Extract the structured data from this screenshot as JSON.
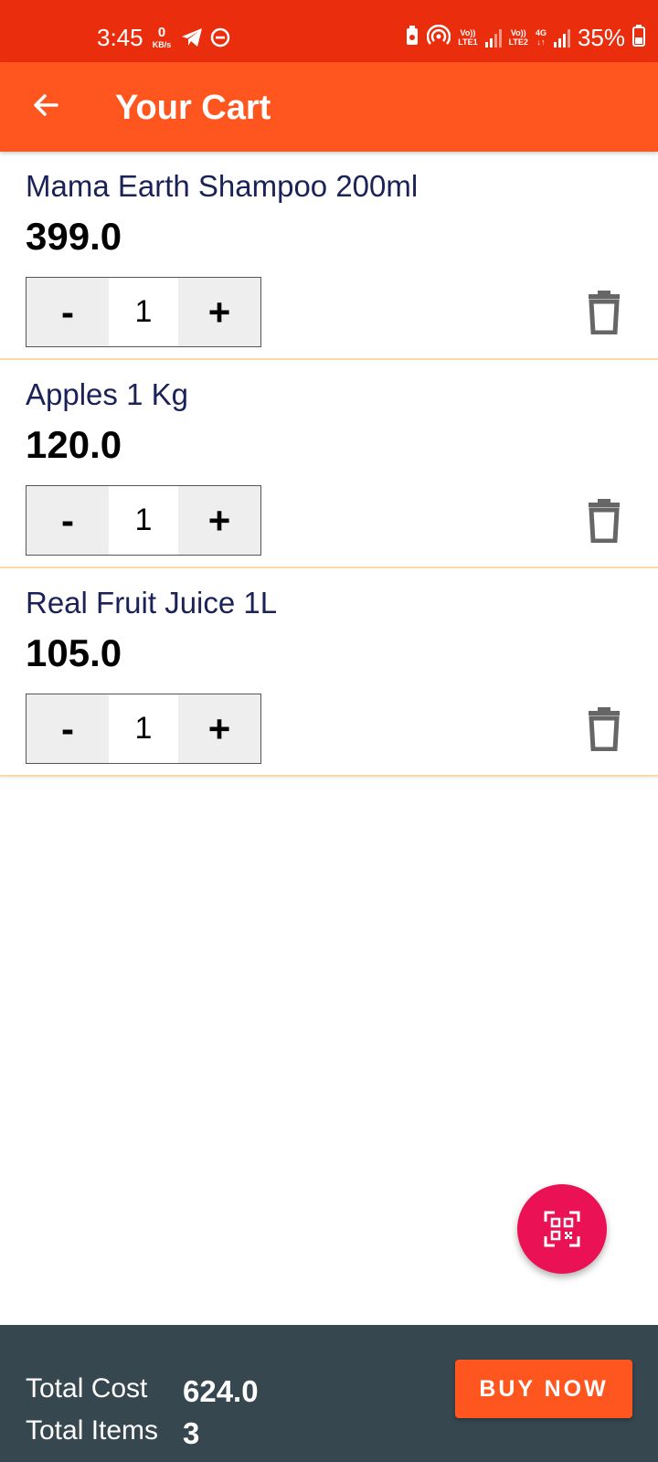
{
  "status_bar": {
    "time": "3:45",
    "net_speed_value": "0",
    "net_speed_unit": "KB/s",
    "sim1_label_top": "Vo))",
    "sim1_label_bottom": "LTE1",
    "sim2_label_top": "Vo))",
    "sim2_label_bottom": "LTE2",
    "network_type": "4G",
    "battery_percent": "35%",
    "icons": [
      "telegram-icon",
      "dnd-icon",
      "battery-saver-icon",
      "hotspot-icon",
      "signal-icon",
      "battery-icon"
    ]
  },
  "app_bar": {
    "title": "Your Cart",
    "back_icon": "arrow-back-icon"
  },
  "cart": {
    "items": [
      {
        "name": "Mama Earth Shampoo 200ml",
        "price": "399.0",
        "quantity": "1",
        "minus_label": "-",
        "plus_label": "+"
      },
      {
        "name": "Apples 1 Kg",
        "price": "120.0",
        "quantity": "1",
        "minus_label": "-",
        "plus_label": "+"
      },
      {
        "name": "Real Fruit Juice 1L",
        "price": "105.0",
        "quantity": "1",
        "minus_label": "-",
        "plus_label": "+"
      }
    ]
  },
  "fab": {
    "icon": "qr-scan-icon"
  },
  "summary": {
    "total_cost_label": "Total Cost",
    "total_cost_value": "624.0",
    "total_items_label": "Total Items",
    "total_items_value": "3",
    "buy_button": "BUY NOW"
  },
  "colors": {
    "status_bar": "#ea2e0d",
    "app_bar": "#fe561e",
    "fab": "#ea1255",
    "bottom_bar": "#37474f",
    "item_name": "#1a2257",
    "divider": "#fcd8a5"
  }
}
